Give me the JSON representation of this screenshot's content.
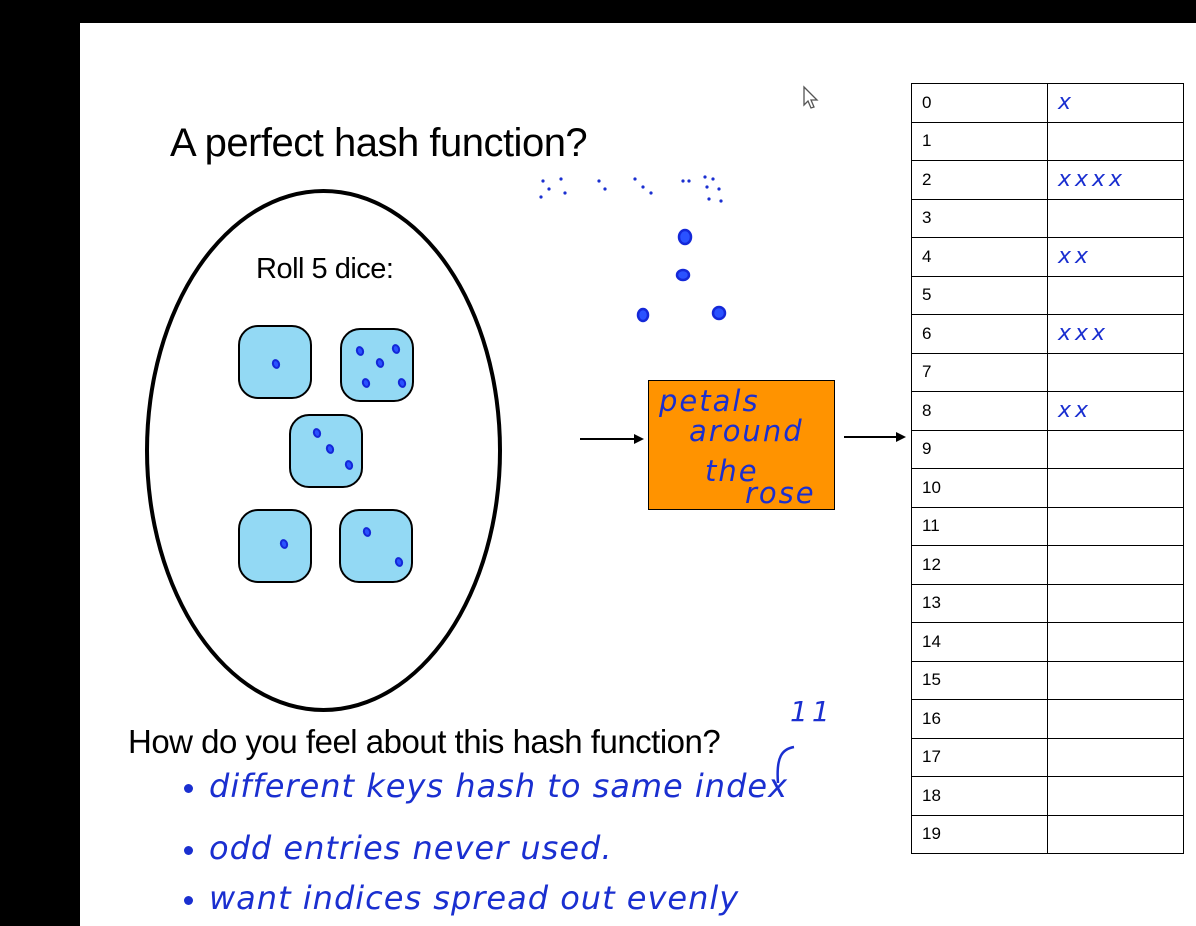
{
  "slide": {
    "title": "A perfect hash function?",
    "question": "How do you feel about this hash function?"
  },
  "dice": {
    "label": "Roll 5 dice:"
  },
  "function_box": {
    "lines": [
      "petals",
      "around",
      "the",
      "rose"
    ]
  },
  "hash_table": {
    "rows": [
      {
        "index": "0",
        "marks": "x"
      },
      {
        "index": "1",
        "marks": ""
      },
      {
        "index": "2",
        "marks": "xxxx"
      },
      {
        "index": "3",
        "marks": ""
      },
      {
        "index": "4",
        "marks": "xx"
      },
      {
        "index": "5",
        "marks": ""
      },
      {
        "index": "6",
        "marks": "xxx"
      },
      {
        "index": "7",
        "marks": ""
      },
      {
        "index": "8",
        "marks": "xx"
      },
      {
        "index": "9",
        "marks": ""
      },
      {
        "index": "10",
        "marks": ""
      },
      {
        "index": "11",
        "marks": ""
      },
      {
        "index": "12",
        "marks": ""
      },
      {
        "index": "13",
        "marks": ""
      },
      {
        "index": "14",
        "marks": ""
      },
      {
        "index": "15",
        "marks": ""
      },
      {
        "index": "16",
        "marks": ""
      },
      {
        "index": "17",
        "marks": ""
      },
      {
        "index": "18",
        "marks": ""
      },
      {
        "index": "19",
        "marks": ""
      }
    ]
  },
  "annotations": {
    "margin_mark": "11",
    "notes": [
      "different keys hash to same index",
      "odd entries never used.",
      "want indices spread out evenly"
    ]
  },
  "colors": {
    "ink": "#1a2fd0",
    "die_fill": "#93d9f4",
    "function_fill": "#ff9300"
  }
}
